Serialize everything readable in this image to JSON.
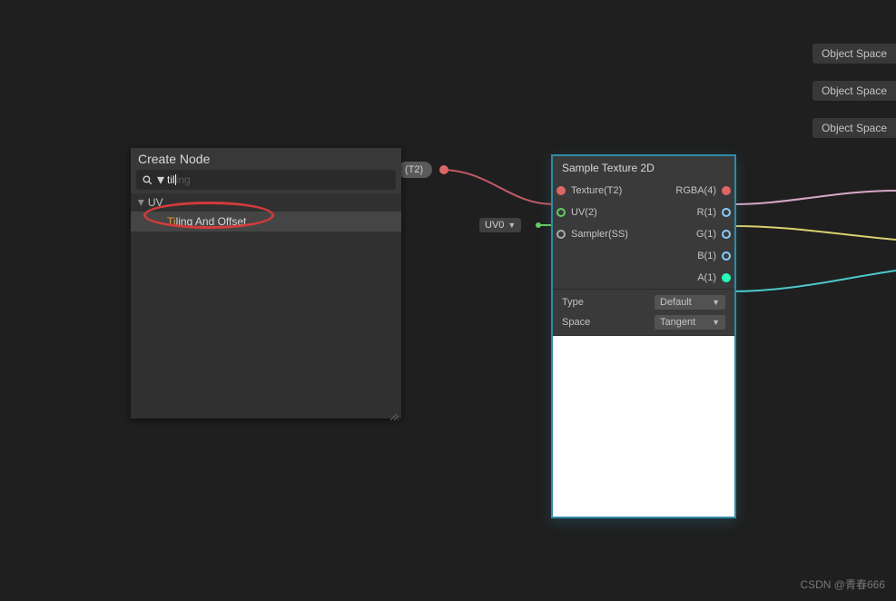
{
  "space_pills": [
    "Object Space",
    "Object Space",
    "Object Space"
  ],
  "create_node": {
    "title": "Create Node",
    "search_typed": "til",
    "search_remainder": "ing",
    "category": "UV",
    "result_hl": "Ti",
    "result_rest": "ling And Offset"
  },
  "bg_port": {
    "label": "(T2)"
  },
  "uv_dropdown": "UV0",
  "node": {
    "title": "Sample Texture 2D",
    "inputs": [
      {
        "label": "Texture(T2)",
        "color": "#d66",
        "filled": true
      },
      {
        "label": "UV(2)",
        "color": "#6c6",
        "filled": false
      },
      {
        "label": "Sampler(SS)",
        "color": "#aaa",
        "filled": false
      }
    ],
    "outputs": [
      {
        "label": "RGBA(4)",
        "color": "#d66",
        "filled": true
      },
      {
        "label": "R(1)",
        "color": "#8cf",
        "filled": false
      },
      {
        "label": "G(1)",
        "color": "#8cf",
        "filled": false
      },
      {
        "label": "B(1)",
        "color": "#8cf",
        "filled": false
      },
      {
        "label": "A(1)",
        "color": "#2fb",
        "filled": true
      }
    ],
    "settings": [
      {
        "label": "Type",
        "value": "Default"
      },
      {
        "label": "Space",
        "value": "Tangent"
      }
    ]
  },
  "watermark": "CSDN @青春666"
}
